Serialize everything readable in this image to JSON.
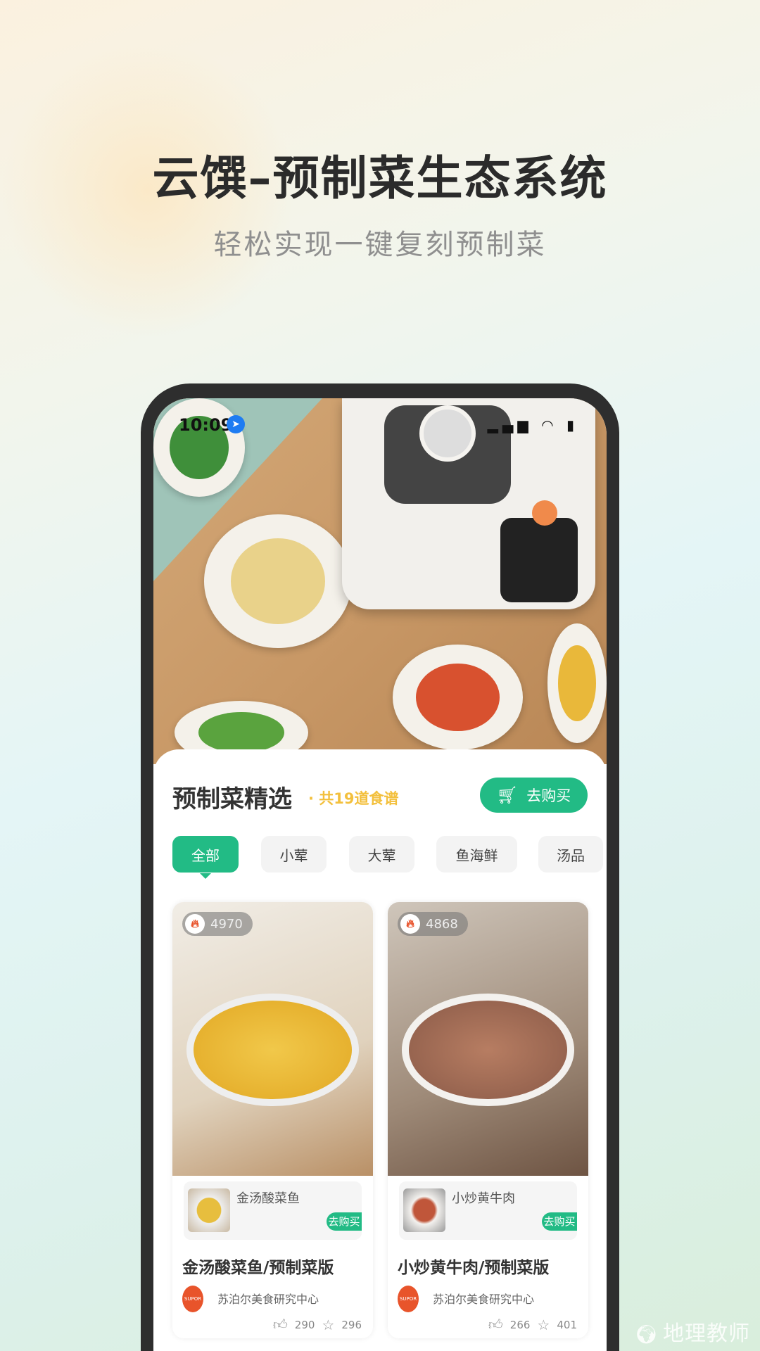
{
  "header": {
    "title": "云馔–预制菜生态系统",
    "subtitle": "轻松实现一键复刻预制菜"
  },
  "status_bar": {
    "time": "10:09",
    "icons": [
      "location-arrow-icon",
      "signal-icon",
      "wifi-icon",
      "battery-icon"
    ]
  },
  "section": {
    "title": "预制菜精选",
    "count": "· 共19道食谱",
    "buy_label": "去购买",
    "accent": "#22bb85",
    "count_color": "#f3c03d"
  },
  "tabs": [
    {
      "label": "全部",
      "active": true
    },
    {
      "label": "小荤"
    },
    {
      "label": "大荤"
    },
    {
      "label": "鱼海鲜"
    },
    {
      "label": "汤品"
    }
  ],
  "cards": [
    {
      "heat": "4970",
      "product": "金汤酸菜鱼",
      "product_buy": "去购买",
      "title": "金汤酸菜鱼/预制菜版",
      "author": "苏泊尔美食研究中心",
      "avatar_text": "SUPOR",
      "likes": "290",
      "favorites": "296"
    },
    {
      "heat": "4868",
      "product": "小炒黄牛肉",
      "product_buy": "去购买",
      "title": "小炒黄牛肉/预制菜版",
      "author": "苏泊尔美食研究中心",
      "avatar_text": "SUPOR",
      "likes": "266",
      "favorites": "401"
    }
  ],
  "watermark": "地理教师"
}
